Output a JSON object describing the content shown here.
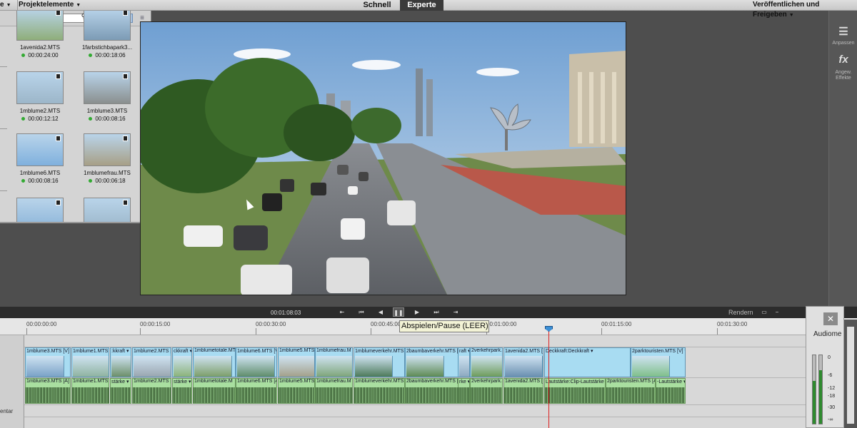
{
  "menu": {
    "left_partial": "e",
    "project": "Projektelemente",
    "publish": "Veröffentlichen und Freigeben"
  },
  "modes": {
    "quick": "Schnell",
    "expert": "Experte"
  },
  "search": {
    "icon": "search-icon"
  },
  "project_clips": [
    {
      "name": "1avenida2.MTS",
      "duration": "00:00:24:00",
      "row": 0,
      "col": 0
    },
    {
      "name": "1farbstichbapark3...",
      "duration": "00:00:18:06",
      "row": 0,
      "col": 1
    },
    {
      "name": "1mblume2.MTS",
      "duration": "00:00:12:12",
      "row": 1,
      "col": 0
    },
    {
      "name": "1mblume3.MTS",
      "duration": "00:00:08:16",
      "row": 1,
      "col": 1
    },
    {
      "name": "1mblume6.MTS",
      "duration": "00:00:08:16",
      "row": 2,
      "col": 0
    },
    {
      "name": "1mblumefrau.MTS",
      "duration": "00:00:06:18",
      "row": 2,
      "col": 1
    },
    {
      "name": "",
      "duration": "",
      "row": 3,
      "col": 0
    },
    {
      "name": "",
      "duration": "",
      "row": 3,
      "col": 1
    }
  ],
  "right_panel": {
    "adjust": "Anpassen",
    "effects_icon": "fx",
    "effects": "Angew. Effekte"
  },
  "playback": {
    "timecode": "00:01:08:03",
    "render": "Rendern",
    "tooltip": "Abspielen/Pause (LEER)"
  },
  "ruler": [
    "00:00:00:00",
    "00:00:15:00",
    "00:00:30:00",
    "00:00:45:00",
    "00:01:00:00",
    "00:01:15:00",
    "00:01:30:00"
  ],
  "track_label": "entar",
  "video_clips": [
    {
      "label": "1mblume3.MTS [V] ▾"
    },
    {
      "label": "1mblume1.MTS [V] ▾"
    },
    {
      "label": ":kkraft ▾"
    },
    {
      "label": "1mblume2.MTS [V] ▾"
    },
    {
      "label": "ckkraft ▾"
    },
    {
      "label": "1mblumetotale.MTS"
    },
    {
      "label": "1mblume6.MTS [V] ▾"
    },
    {
      "label": "1mblume5.MTS"
    },
    {
      "label": "1mblumefrau.M"
    },
    {
      "label": "1mblumeverkehr.MTS [V] ▾"
    },
    {
      "label": "2baumbaverkehr.MTS [V] ▾"
    },
    {
      "label": "raft ▾"
    },
    {
      "label": "2verkehrpark."
    },
    {
      "label": "1avenida2.MTS [V] ▾"
    },
    {
      "label": "Deckkraft:Deckkraft ▾"
    },
    {
      "label": "2parktouristen.MTS [V] ▾"
    }
  ],
  "audio_clips": [
    {
      "label": "1mblume3.MTS [A]"
    },
    {
      "label": "1mblume1.MTS [A]"
    },
    {
      "label": "stärke ▾"
    },
    {
      "label": "1mblume2.MTS [A]"
    },
    {
      "label": "stärke ▾"
    },
    {
      "label": "1mblumetotale.M"
    },
    {
      "label": "1mblume6.MTS [A]"
    },
    {
      "label": "1mblume5.MTS [A]"
    },
    {
      "label": "1mblumefrau.M"
    },
    {
      "label": "1mblumeverkehr.MTS [A]"
    },
    {
      "label": "2baumbaverkehr.MTS [A]"
    },
    {
      "label": "rke ▾"
    },
    {
      "label": "2verkehrpark."
    },
    {
      "label": "1avenida2.MTS [A]"
    },
    {
      "label": "Lautstärke:Clip-Lautstärke ▾"
    },
    {
      "label": "2parktouristen.MTS [A]"
    },
    {
      "label": "-Lautstärke ▾"
    }
  ],
  "audio_meter": {
    "close": "✕",
    "title": "Audiome",
    "labels": [
      "0",
      "-6",
      "-12",
      "-18",
      "-30",
      "-∞"
    ],
    "left_level": 0.62,
    "right_level": 0.78
  }
}
